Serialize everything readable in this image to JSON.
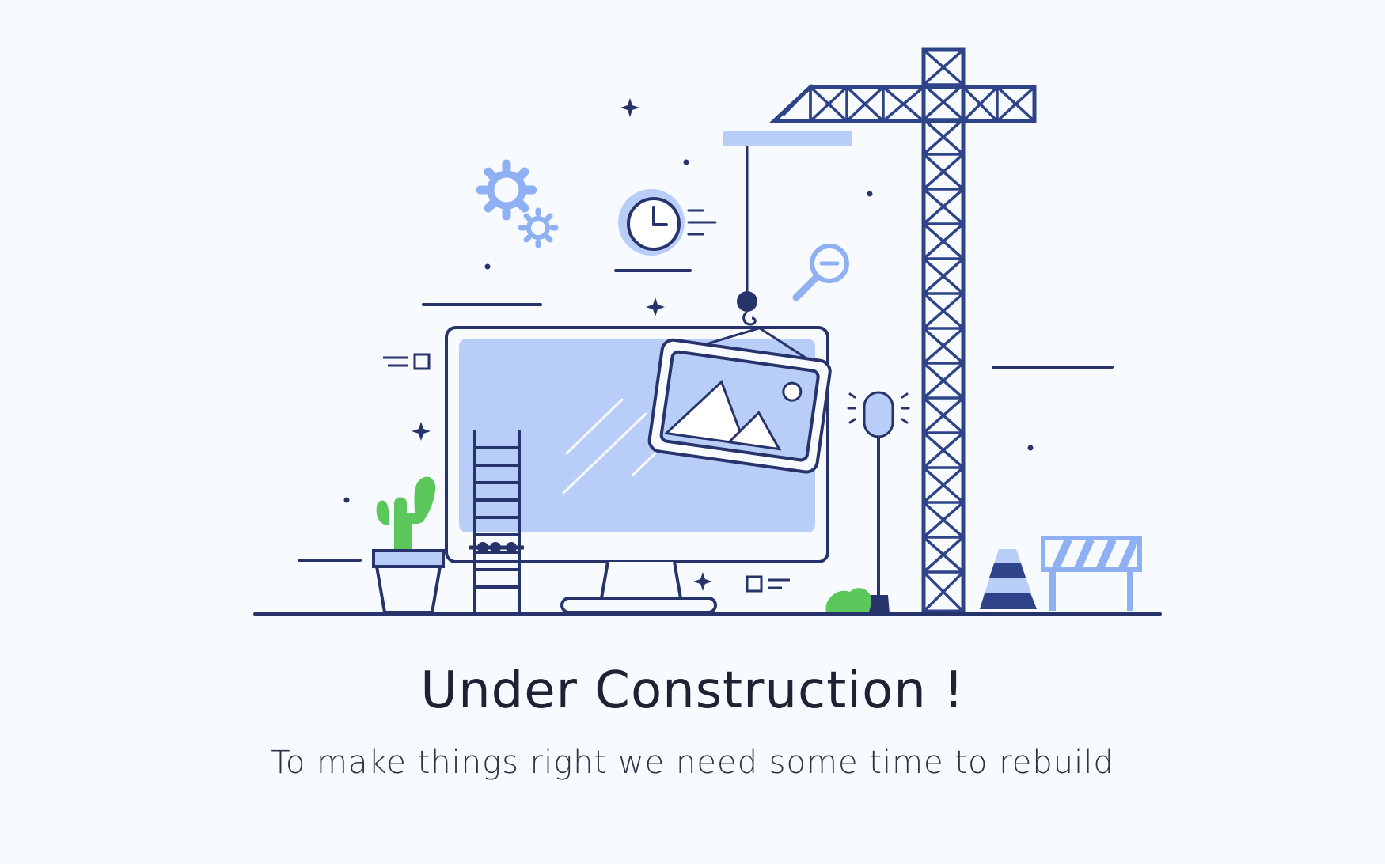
{
  "heading": {
    "title": "Under Construction !",
    "subtitle": "To make things right we need some time to rebuild"
  },
  "colors": {
    "background": "#f7faff",
    "line": "#27336b",
    "crane": "#2f4488",
    "accent_light": "#b8cdf7",
    "accent_mid": "#8fb0f2",
    "plant_green": "#5cc85c",
    "text": "#1e2233"
  },
  "illustration": {
    "icons": [
      "crane-icon",
      "monitor-icon",
      "image-frame-icon",
      "ladder-icon",
      "cactus-icon",
      "gear-icon",
      "clock-icon",
      "magnifier-zoom-out-icon",
      "lamp-post-icon",
      "traffic-cone-icon",
      "road-barrier-icon",
      "bush-icon"
    ]
  }
}
